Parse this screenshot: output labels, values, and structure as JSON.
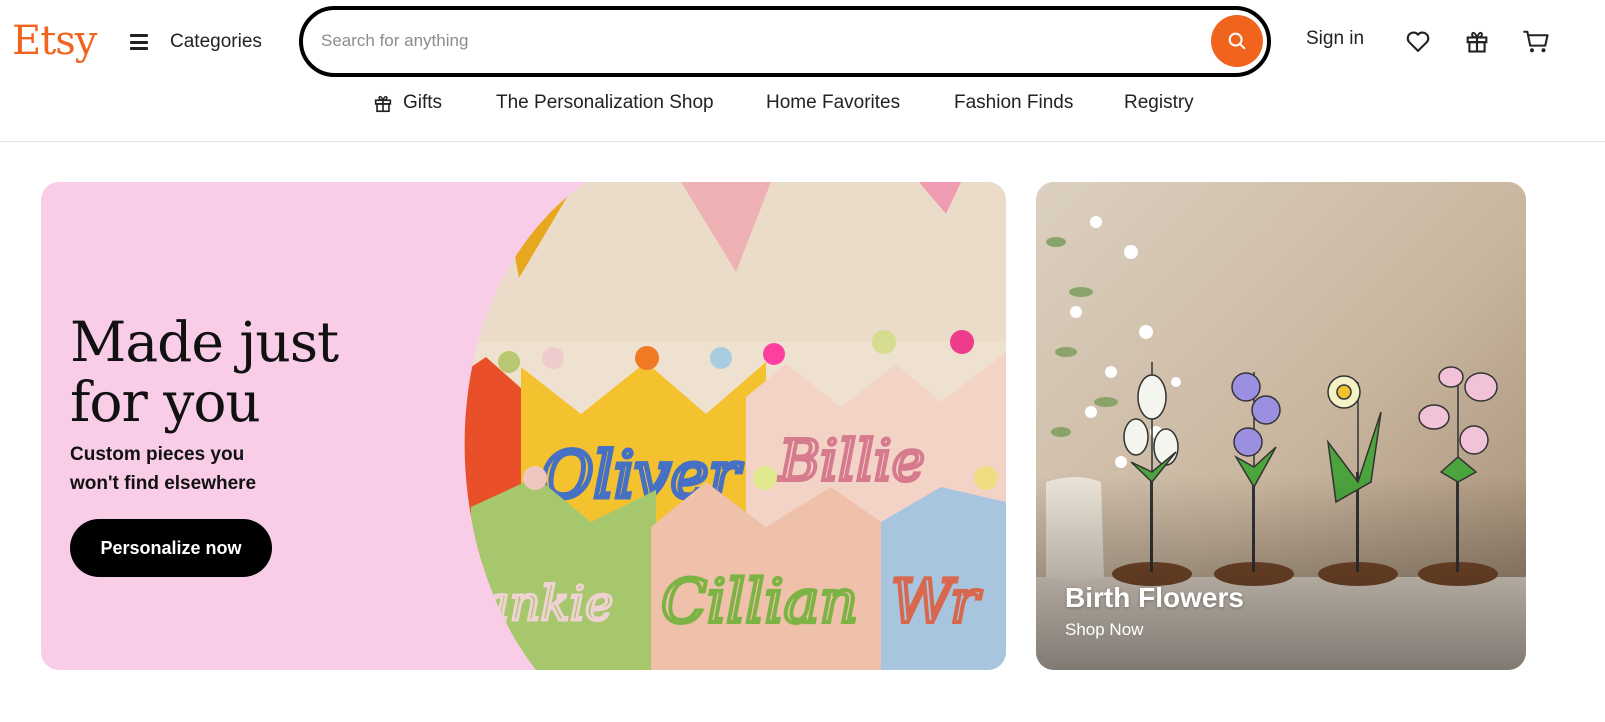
{
  "header": {
    "logo": "Etsy",
    "categories_label": "Categories",
    "search": {
      "placeholder": "Search for anything",
      "value": ""
    },
    "sign_in_label": "Sign in",
    "icons": [
      "hamburger-icon",
      "search-icon",
      "heart-icon",
      "gift-icon",
      "cart-icon"
    ]
  },
  "nav": {
    "items": [
      {
        "label": "Gifts",
        "icon": "gift-icon"
      },
      {
        "label": "The Personalization Shop"
      },
      {
        "label": "Home Favorites"
      },
      {
        "label": "Fashion Finds"
      },
      {
        "label": "Registry"
      }
    ]
  },
  "hero": {
    "title": "Made just for you",
    "subtitle": "Custom pieces you won't find elsewhere",
    "button_label": "Personalize now",
    "crown_names": [
      "Oliver",
      "Billie",
      "Cillian",
      "ankie",
      "Wr"
    ]
  },
  "promo": {
    "title": "Birth Flowers",
    "link_label": "Shop Now"
  },
  "colors": {
    "brand": "#f1641e",
    "hero_bg": "#f9cde8",
    "button_bg": "#000000",
    "text": "#222222"
  }
}
